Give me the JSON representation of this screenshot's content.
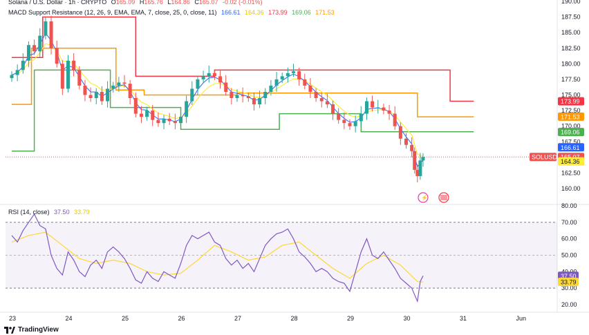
{
  "header": {
    "symbol_title": "Solana / U.S. Dollar · 1h · CRYPTO",
    "ohlc": [
      {
        "k": "O",
        "v": "165.09"
      },
      {
        "k": "H",
        "v": "165.76"
      },
      {
        "k": "L",
        "v": "164.86"
      },
      {
        "k": "C",
        "v": "165.07"
      }
    ],
    "change": "-0.02 (-0.01%)",
    "indicator_name": "MACD Support Resistance (12, 26, 9, EMA, EMA, 7, close, 25, 0, close, 11)",
    "indicator_values": [
      "166.61",
      "164.36",
      "173.99",
      "169.06",
      "171.53"
    ]
  },
  "rsi_header": {
    "label": "RSI (14, close)",
    "v1": "37.50",
    "v2": "33.79"
  },
  "branding": {
    "name": "TradingView"
  },
  "colors": {
    "up": "#26a69a",
    "down": "#ef5350",
    "red_line": "#f23645",
    "orange_line": "#ff9800",
    "green_line": "#4caf50",
    "blue_line": "#2962ff",
    "yellow_line": "#ffeb3b",
    "rsi_line": "#7e57c2",
    "rsi_ma": "#fdd835"
  },
  "icons": [
    "flash-event-icon",
    "us-flag-event-icon"
  ],
  "chart_data": [
    {
      "type": "candlestick",
      "title": "Solana / U.S. Dollar · 1h · CRYPTO",
      "x_ticks": [
        "23",
        "24",
        "25",
        "26",
        "27",
        "28",
        "29",
        "30",
        "31",
        "Jun"
      ],
      "y_ticks": [
        "160.00",
        "162.50",
        "165.00",
        "167.50",
        "170.00",
        "172.50",
        "175.00",
        "177.50",
        "180.00",
        "182.50",
        "185.00",
        "187.50",
        "190.00"
      ],
      "ylim": [
        158.5,
        190.5
      ],
      "price_labels": [
        {
          "text": "173.99",
          "value": 173.99,
          "color": "#f23645"
        },
        {
          "text": "171.53",
          "value": 171.53,
          "color": "#ff9800"
        },
        {
          "text": "169.06",
          "value": 169.06,
          "color": "#4caf50"
        },
        {
          "text": "166.61",
          "value": 166.61,
          "color": "#2962ff"
        },
        {
          "text": "165.07",
          "value": 165.07,
          "color": "#ef5350",
          "tag": "SOLUSD"
        },
        {
          "text": "164.36",
          "value": 164.36,
          "color": "#ffeb3b"
        }
      ],
      "close_path": [
        [
          23.0,
          178.2
        ],
        [
          23.1,
          179.0
        ],
        [
          23.2,
          180.5
        ],
        [
          23.3,
          183.0
        ],
        [
          23.4,
          182.0
        ],
        [
          23.5,
          184.5
        ],
        [
          23.6,
          186.8
        ],
        [
          23.7,
          182.5
        ],
        [
          23.8,
          180.0
        ],
        [
          23.9,
          176.0
        ],
        [
          24.0,
          180.5
        ],
        [
          24.1,
          179.0
        ],
        [
          24.2,
          176.5
        ],
        [
          24.3,
          175.0
        ],
        [
          24.4,
          174.5
        ],
        [
          24.5,
          175.5
        ],
        [
          24.6,
          174.0
        ],
        [
          24.7,
          176.0
        ],
        [
          24.8,
          176.5
        ],
        [
          24.9,
          177.0
        ],
        [
          25.0,
          176.8
        ],
        [
          25.1,
          174.5
        ],
        [
          25.2,
          172.0
        ],
        [
          25.3,
          171.5
        ],
        [
          25.4,
          172.5
        ],
        [
          25.5,
          171.0
        ],
        [
          25.6,
          170.5
        ],
        [
          25.7,
          171.2
        ],
        [
          25.8,
          170.8
        ],
        [
          25.9,
          170.5
        ],
        [
          26.0,
          171.5
        ],
        [
          26.1,
          174.0
        ],
        [
          26.2,
          176.0
        ],
        [
          26.3,
          177.5
        ],
        [
          26.4,
          178.0
        ],
        [
          26.5,
          178.5
        ],
        [
          26.6,
          178.0
        ],
        [
          26.7,
          177.0
        ],
        [
          26.8,
          175.5
        ],
        [
          26.9,
          174.5
        ],
        [
          27.0,
          175.0
        ],
        [
          27.1,
          174.8
        ],
        [
          27.2,
          174.5
        ],
        [
          27.3,
          173.5
        ],
        [
          27.4,
          174.5
        ],
        [
          27.5,
          175.5
        ],
        [
          27.6,
          176.5
        ],
        [
          27.7,
          177.5
        ],
        [
          27.8,
          178.0
        ],
        [
          27.9,
          178.5
        ],
        [
          28.0,
          178.8
        ],
        [
          28.1,
          177.5
        ],
        [
          28.2,
          176.5
        ],
        [
          28.3,
          175.5
        ],
        [
          28.4,
          174.5
        ],
        [
          28.5,
          174.0
        ],
        [
          28.6,
          173.5
        ],
        [
          28.7,
          172.0
        ],
        [
          28.8,
          171.0
        ],
        [
          28.9,
          170.5
        ],
        [
          29.0,
          170.0
        ],
        [
          29.1,
          170.8
        ],
        [
          29.2,
          172.0
        ],
        [
          29.3,
          174.0
        ],
        [
          29.4,
          173.0
        ],
        [
          29.5,
          173.0
        ],
        [
          29.6,
          172.5
        ],
        [
          29.7,
          172.0
        ],
        [
          29.8,
          170.0
        ],
        [
          29.9,
          168.0
        ],
        [
          30.0,
          167.0
        ],
        [
          30.1,
          166.0
        ],
        [
          30.15,
          163.0
        ],
        [
          30.2,
          162.0
        ],
        [
          30.25,
          164.5
        ],
        [
          30.3,
          165.07
        ]
      ],
      "levels": {
        "red": [
          [
            23.0,
            181.0
          ],
          [
            23.55,
            181.0
          ],
          [
            23.55,
            187.5
          ],
          [
            25.2,
            187.5
          ],
          [
            25.2,
            178.0
          ],
          [
            26.6,
            178.0
          ],
          [
            26.6,
            179.0
          ],
          [
            30.78,
            179.0
          ],
          [
            30.78,
            174.0
          ],
          [
            31.2,
            174.0
          ]
        ],
        "orange": [
          [
            23.0,
            173.5
          ],
          [
            23.35,
            173.5
          ],
          [
            23.35,
            182.5
          ],
          [
            24.85,
            182.5
          ],
          [
            24.85,
            175.8
          ],
          [
            25.35,
            175.8
          ],
          [
            25.35,
            175.0
          ],
          [
            27.0,
            175.0
          ],
          [
            27.0,
            175.3
          ],
          [
            30.2,
            175.3
          ],
          [
            30.2,
            171.5
          ],
          [
            31.2,
            171.5
          ]
        ],
        "green": [
          [
            23.0,
            166.0
          ],
          [
            23.4,
            166.0
          ],
          [
            23.4,
            179.0
          ],
          [
            24.75,
            179.0
          ],
          [
            24.75,
            173.0
          ],
          [
            26.0,
            173.0
          ],
          [
            26.0,
            169.5
          ],
          [
            27.75,
            169.5
          ],
          [
            27.75,
            172.0
          ],
          [
            29.2,
            172.0
          ],
          [
            29.2,
            169.1
          ],
          [
            31.2,
            169.1
          ]
        ]
      }
    },
    {
      "type": "line",
      "title": "RSI (14, close)",
      "y_ticks": [
        "20.00",
        "30.00",
        "40.00",
        "50.00",
        "60.00",
        "70.00",
        "80.00"
      ],
      "ylim": [
        16,
        82
      ],
      "x_ticks": [
        "23",
        "24",
        "25",
        "26",
        "27",
        "28",
        "29",
        "30",
        "31",
        "Jun"
      ],
      "band": [
        30,
        70
      ],
      "midline": 50,
      "series": [
        {
          "values": [
            [
              23.0,
              62
            ],
            [
              23.1,
              58
            ],
            [
              23.2,
              65
            ],
            [
              23.3,
              70
            ],
            [
              23.4,
              75
            ],
            [
              23.5,
              68
            ],
            [
              23.6,
              66
            ],
            [
              23.7,
              50
            ],
            [
              23.8,
              42
            ],
            [
              23.9,
              38
            ],
            [
              24.0,
              52
            ],
            [
              24.1,
              47
            ],
            [
              24.2,
              40
            ],
            [
              24.3,
              37
            ],
            [
              24.4,
              44
            ],
            [
              24.5,
              47
            ],
            [
              24.6,
              42
            ],
            [
              24.7,
              52
            ],
            [
              24.8,
              55
            ],
            [
              24.9,
              52
            ],
            [
              25.0,
              48
            ],
            [
              25.1,
              42
            ],
            [
              25.2,
              35
            ],
            [
              25.3,
              33
            ],
            [
              25.4,
              40
            ],
            [
              25.5,
              36
            ],
            [
              25.6,
              34
            ],
            [
              25.7,
              40
            ],
            [
              25.8,
              38
            ],
            [
              25.9,
              36
            ],
            [
              26.0,
              45
            ],
            [
              26.1,
              56
            ],
            [
              26.2,
              62
            ],
            [
              26.3,
              60
            ],
            [
              26.4,
              62
            ],
            [
              26.5,
              64
            ],
            [
              26.6,
              58
            ],
            [
              26.7,
              56
            ],
            [
              26.8,
              48
            ],
            [
              26.9,
              44
            ],
            [
              27.0,
              47
            ],
            [
              27.1,
              42
            ],
            [
              27.2,
              45
            ],
            [
              27.3,
              40
            ],
            [
              27.4,
              48
            ],
            [
              27.5,
              56
            ],
            [
              27.6,
              60
            ],
            [
              27.7,
              63
            ],
            [
              27.8,
              64
            ],
            [
              27.9,
              66
            ],
            [
              28.0,
              60
            ],
            [
              28.1,
              52
            ],
            [
              28.2,
              49
            ],
            [
              28.3,
              45
            ],
            [
              28.4,
              40
            ],
            [
              28.5,
              42
            ],
            [
              28.6,
              40
            ],
            [
              28.7,
              36
            ],
            [
              28.8,
              34
            ],
            [
              28.9,
              33
            ],
            [
              29.0,
              28
            ],
            [
              29.1,
              40
            ],
            [
              29.2,
              52
            ],
            [
              29.3,
              60
            ],
            [
              29.4,
              50
            ],
            [
              29.5,
              48
            ],
            [
              29.6,
              52
            ],
            [
              29.7,
              47
            ],
            [
              29.8,
              42
            ],
            [
              29.9,
              36
            ],
            [
              30.0,
              33
            ],
            [
              30.1,
              30
            ],
            [
              30.15,
              26
            ],
            [
              30.2,
              22
            ],
            [
              30.25,
              34
            ],
            [
              30.3,
              37.5
            ]
          ]
        },
        {
          "values": [
            [
              23.0,
              58
            ],
            [
              23.3,
              62
            ],
            [
              23.6,
              64
            ],
            [
              23.9,
              56
            ],
            [
              24.2,
              48
            ],
            [
              24.5,
              45
            ],
            [
              24.8,
              47
            ],
            [
              25.1,
              45
            ],
            [
              25.4,
              40
            ],
            [
              25.7,
              38
            ],
            [
              26.0,
              39
            ],
            [
              26.3,
              47
            ],
            [
              26.6,
              56
            ],
            [
              26.9,
              52
            ],
            [
              27.2,
              47
            ],
            [
              27.5,
              49
            ],
            [
              27.8,
              56
            ],
            [
              28.1,
              58
            ],
            [
              28.4,
              50
            ],
            [
              28.7,
              42
            ],
            [
              29.0,
              36
            ],
            [
              29.3,
              45
            ],
            [
              29.6,
              50
            ],
            [
              29.9,
              44
            ],
            [
              30.2,
              34
            ],
            [
              30.3,
              33.8
            ]
          ]
        }
      ]
    }
  ]
}
